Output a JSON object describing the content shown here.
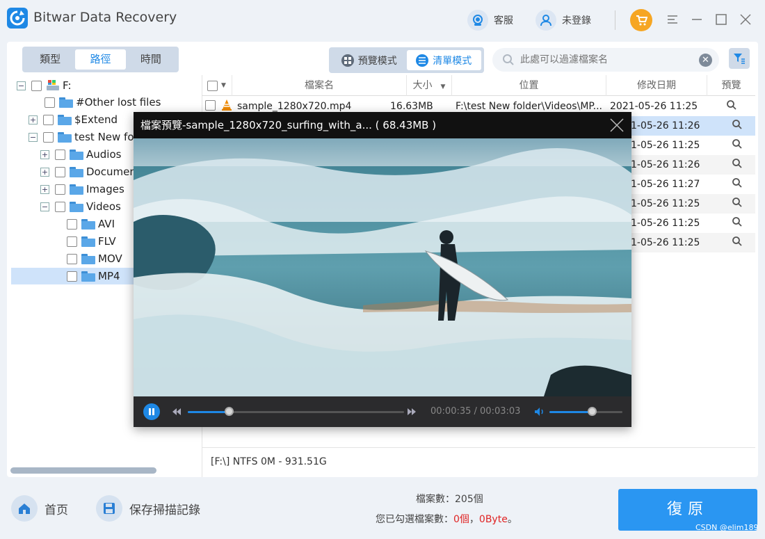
{
  "app": {
    "title": "Bitwar Data Recovery",
    "support_label": "客服",
    "login_label": "未登錄"
  },
  "colors": {
    "accent": "#1e88e5",
    "cart": "#f6a623",
    "selected_row": "#cfe3fa",
    "red": "#e02424"
  },
  "view_tabs": [
    {
      "label": "類型"
    },
    {
      "label": "路徑"
    },
    {
      "label": "時間"
    }
  ],
  "active_view_tab": "路徑",
  "modes": {
    "preview": "預覽模式",
    "list": "清單模式",
    "active": "清單模式"
  },
  "search": {
    "placeholder": "此處可以過濾檔案名"
  },
  "tree": {
    "root": "F:",
    "other_lost": "#Other lost files",
    "extend": "$Extend",
    "test_folder": "test New fol",
    "audios": "Audios",
    "documents": "Documen",
    "images": "Images",
    "videos": "Videos",
    "avi": "AVI",
    "flv": "FLV",
    "mov": "MOV",
    "mp4": "MP4"
  },
  "table": {
    "headers": {
      "name": "檔案名",
      "size": "大小",
      "location": "位置",
      "modified": "修改日期",
      "preview": "預覽"
    },
    "rows": [
      {
        "name": "sample_1280x720.mp4",
        "size": "16.63MB",
        "location": "F:\\test New folder\\Videos\\MP...",
        "date": "2021-05-26  11:25"
      },
      {
        "name": "",
        "size": "",
        "location": "",
        "date": "1-05-26  11:26"
      },
      {
        "name": "",
        "size": "",
        "location": "",
        "date": "1-05-26  11:25"
      },
      {
        "name": "",
        "size": "",
        "location": "",
        "date": "1-05-26  11:26"
      },
      {
        "name": "",
        "size": "",
        "location": "",
        "date": "1-05-26  11:27"
      },
      {
        "name": "",
        "size": "",
        "location": "",
        "date": "1-05-26  11:25"
      },
      {
        "name": "",
        "size": "",
        "location": "",
        "date": "1-05-26  11:25"
      },
      {
        "name": "",
        "size": "",
        "location": "",
        "date": "1-05-26  11:25"
      }
    ]
  },
  "status_text": "[F:\\] NTFS 0M - 931.51G",
  "preview_modal": {
    "title": "檔案預覽-sample_1280x720_surfing_with_a... ( 68.43MB )",
    "time": "00:00:35 / 00:03:03",
    "progress": 0.19,
    "volume": 0.58
  },
  "bottom": {
    "home_label": "首页",
    "save_scan_label": "保存掃描記錄",
    "file_count": "檔案數：205個",
    "selected_prefix": "您已勾選檔案數：",
    "selected_count": "0個",
    "selected_sep": "，",
    "selected_size": "0Byte",
    "selected_suffix": "。",
    "recover_label": "復原"
  },
  "watermark": "CSDN @elim189"
}
